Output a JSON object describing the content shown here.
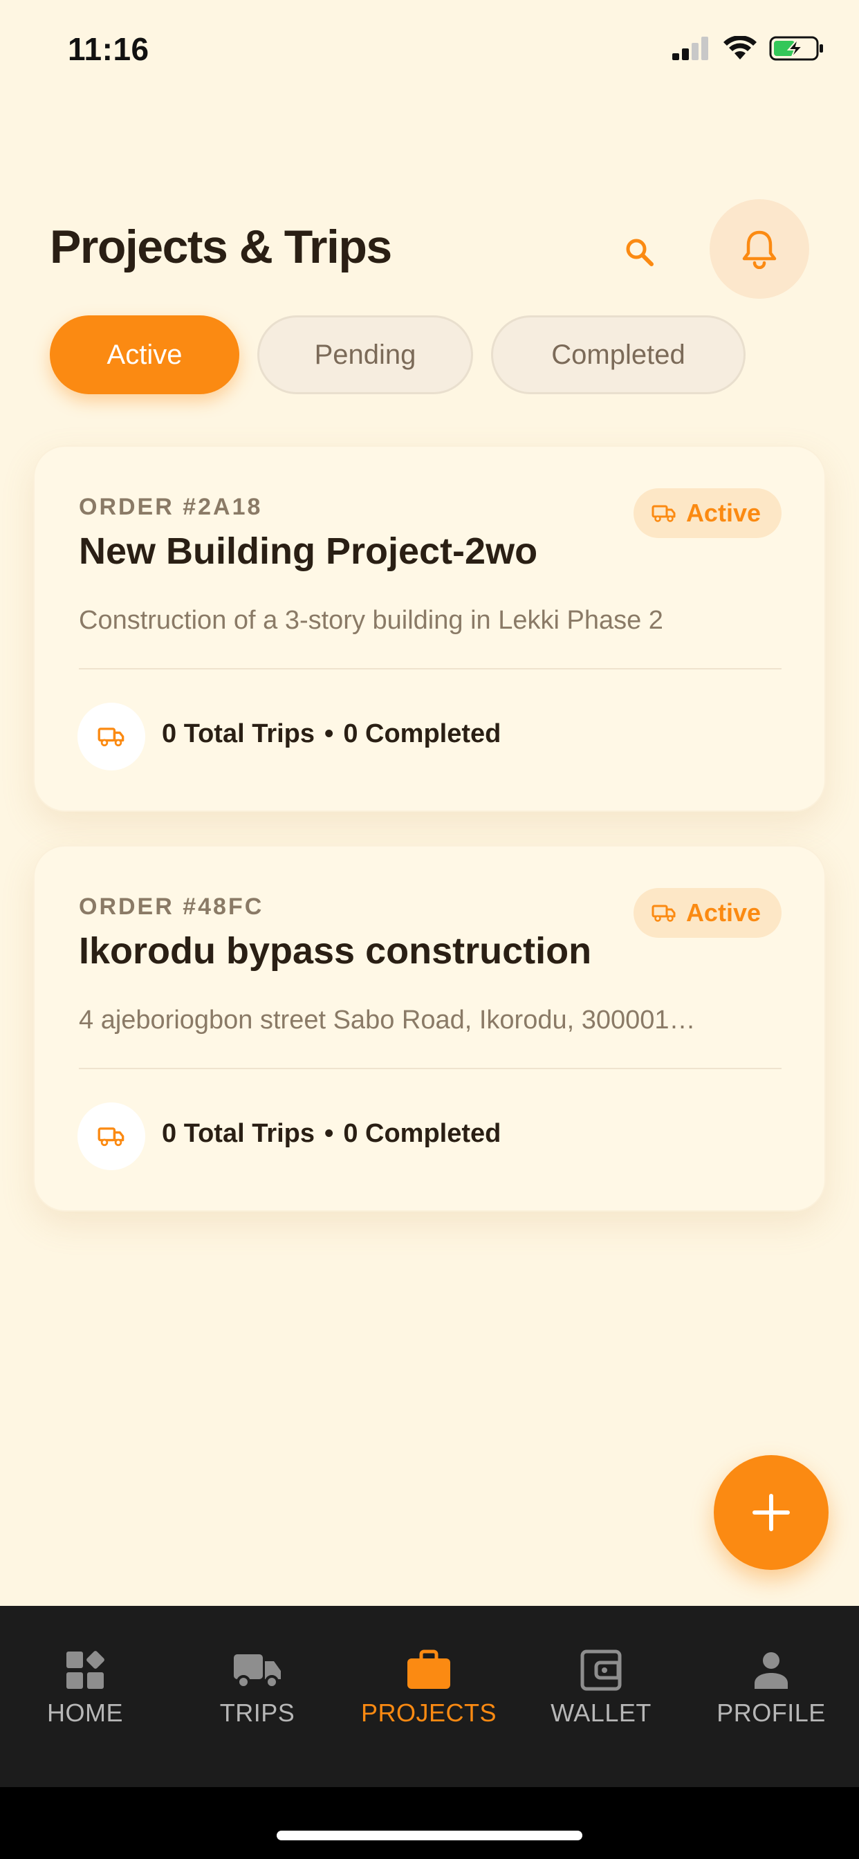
{
  "status_bar": {
    "time": "11:16"
  },
  "header": {
    "title": "Projects & Trips"
  },
  "tabs": [
    {
      "label": "Active",
      "selected": true
    },
    {
      "label": "Pending",
      "selected": false
    },
    {
      "label": "Completed",
      "selected": false
    }
  ],
  "projects": [
    {
      "order": "ORDER #2A18",
      "status": "Active",
      "title": "New Building Project-2wo",
      "description": "Construction of a 3-story building in Lekki Phase 2",
      "total_trips": "0 Total Trips",
      "separator": "•",
      "completed": "0 Completed"
    },
    {
      "order": "ORDER #48FC",
      "status": "Active",
      "title": "Ikorodu bypass construction",
      "description": "4 ajeboriogbon street Sabo Road, Ikorodu, 300001…",
      "total_trips": "0 Total Trips",
      "separator": "•",
      "completed": "0 Completed"
    }
  ],
  "nav": [
    {
      "label": "HOME",
      "icon": "home-icon",
      "active": false
    },
    {
      "label": "TRIPS",
      "icon": "truck-icon",
      "active": false
    },
    {
      "label": "PROJECTS",
      "icon": "briefcase-icon",
      "active": true
    },
    {
      "label": "WALLET",
      "icon": "wallet-icon",
      "active": false
    },
    {
      "label": "PROFILE",
      "icon": "person-icon",
      "active": false
    }
  ],
  "colors": {
    "accent": "#FB8A12",
    "background": "#FEF6E2",
    "nav_bg": "#1C1C1C"
  }
}
